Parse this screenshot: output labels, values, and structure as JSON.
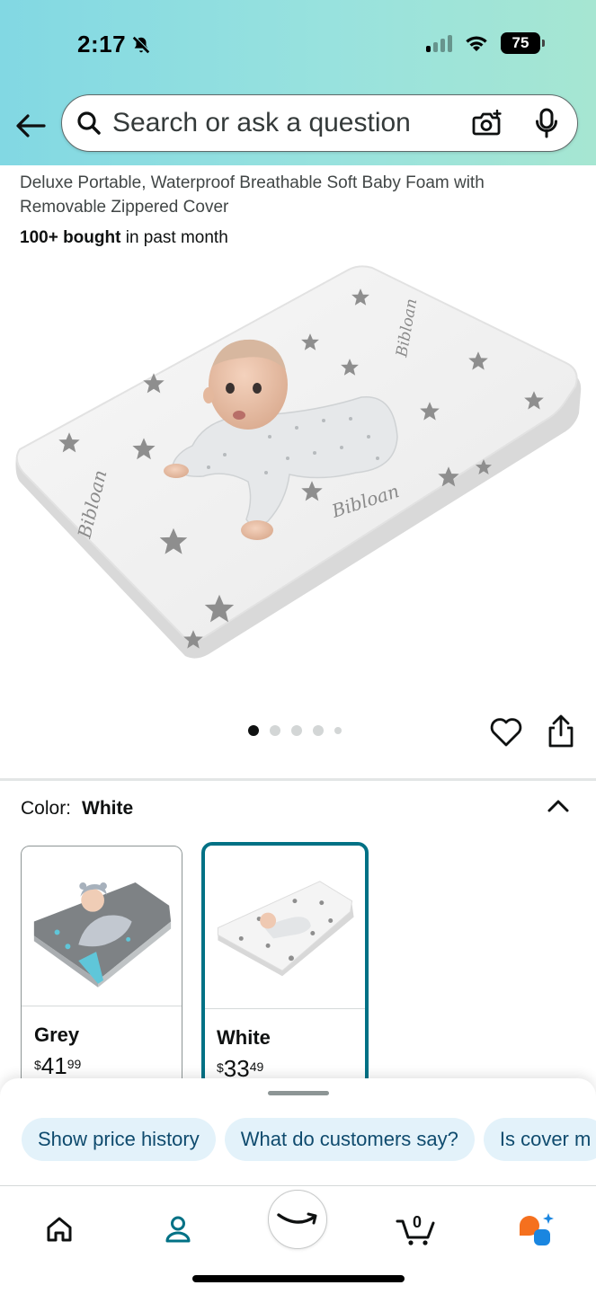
{
  "status": {
    "time": "2:17",
    "battery": "75"
  },
  "search": {
    "placeholder": "Search or ask a question"
  },
  "product": {
    "title_line1": "Deluxe Portable, Waterproof Breathable Soft Baby Foam with",
    "title_line2": "Removable Zippered Cover",
    "bought_bold": "100+ bought",
    "bought_rest": " in past month",
    "image_brand_text": "Bibloan",
    "image_index": 1,
    "image_count": 5
  },
  "color": {
    "label": "Color:",
    "selected": "White",
    "options": [
      {
        "name": "Grey",
        "currency": "$",
        "whole": "41",
        "fraction": "99"
      },
      {
        "name": "White",
        "currency": "$",
        "whole": "33",
        "fraction": "49"
      }
    ]
  },
  "sheet": {
    "chips": [
      "Show price history",
      "What do customers say?",
      "Is cover m"
    ]
  },
  "nav": {
    "cart_count": "0",
    "items": [
      "home-icon",
      "account-icon",
      "amazon-smile-icon",
      "cart-icon",
      "rufus-icon"
    ]
  },
  "colors": {
    "accent": "#007185",
    "chip_bg": "#e3f2fa",
    "header_gradient_start": "#82d8e3",
    "header_gradient_end": "#a6e6d2"
  }
}
